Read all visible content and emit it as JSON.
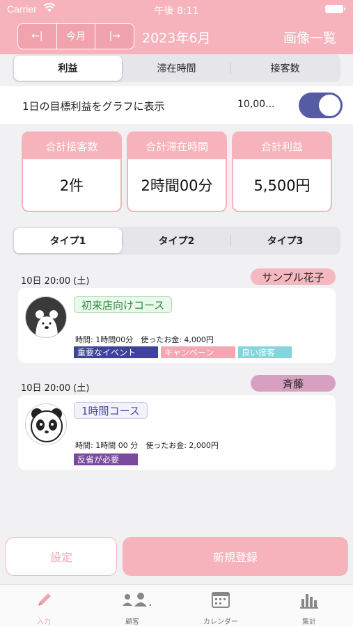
{
  "status_bar": {
    "carrier": "Carrier",
    "time": "午後 8:11"
  },
  "header": {
    "prev_label": "←|",
    "today_label": "今月",
    "next_label": "|→",
    "month": "2023年6月",
    "image_list": "画像一覧"
  },
  "main_tabs": [
    "利益",
    "滞在時間",
    "接客数"
  ],
  "goal_row": {
    "label": "1日の目標利益をグラフに表示",
    "value": "10,00...",
    "toggle_on": true
  },
  "stats": [
    {
      "title": "合計接客数",
      "value": "2件"
    },
    {
      "title": "合計滞在時間",
      "value": "2時間00分"
    },
    {
      "title": "合計利益",
      "value": "5,500円"
    }
  ],
  "type_tabs": [
    "タイプ1",
    "タイプ2",
    "タイプ3"
  ],
  "entries": [
    {
      "date": "10日 20:00 (土)",
      "customer": "サンプル花子",
      "customer_color": "#f3b8c0",
      "course": "初来店向けコース",
      "detail": "時間: 1時間00分　使ったお金: 4,000円",
      "tags": [
        {
          "label": "重要なイベント",
          "color": "#3e4399"
        },
        {
          "label": "キャンペーン",
          "color": "#f3a7b3"
        },
        {
          "label": "良い接客",
          "color": "#85d3dc"
        }
      ],
      "avatar": "polar-bear"
    },
    {
      "date": "10日 20:00 (土)",
      "customer": "斉藤",
      "customer_color": "#d8a0c0",
      "course": "1時間コース",
      "detail": "時間: 1時間 00 分　使ったお金: 2,000円",
      "tags": [
        {
          "label": "反省が必要",
          "color": "#7a4aa0"
        }
      ],
      "avatar": "panda"
    }
  ],
  "buttons": {
    "settings": "設定",
    "new_entry": "新規登録"
  },
  "tabbar": [
    {
      "label": "入力",
      "icon": "pencil-icon",
      "active": true
    },
    {
      "label": "顧客",
      "icon": "people-icon",
      "active": false
    },
    {
      "label": "カレンダー",
      "icon": "calendar-icon",
      "active": false
    },
    {
      "label": "集計",
      "icon": "bar-chart-icon",
      "active": false
    }
  ],
  "colors": {
    "accent": "#f6b3bb",
    "toggle": "#565ca3",
    "active_tab": "#f0a6b0"
  }
}
